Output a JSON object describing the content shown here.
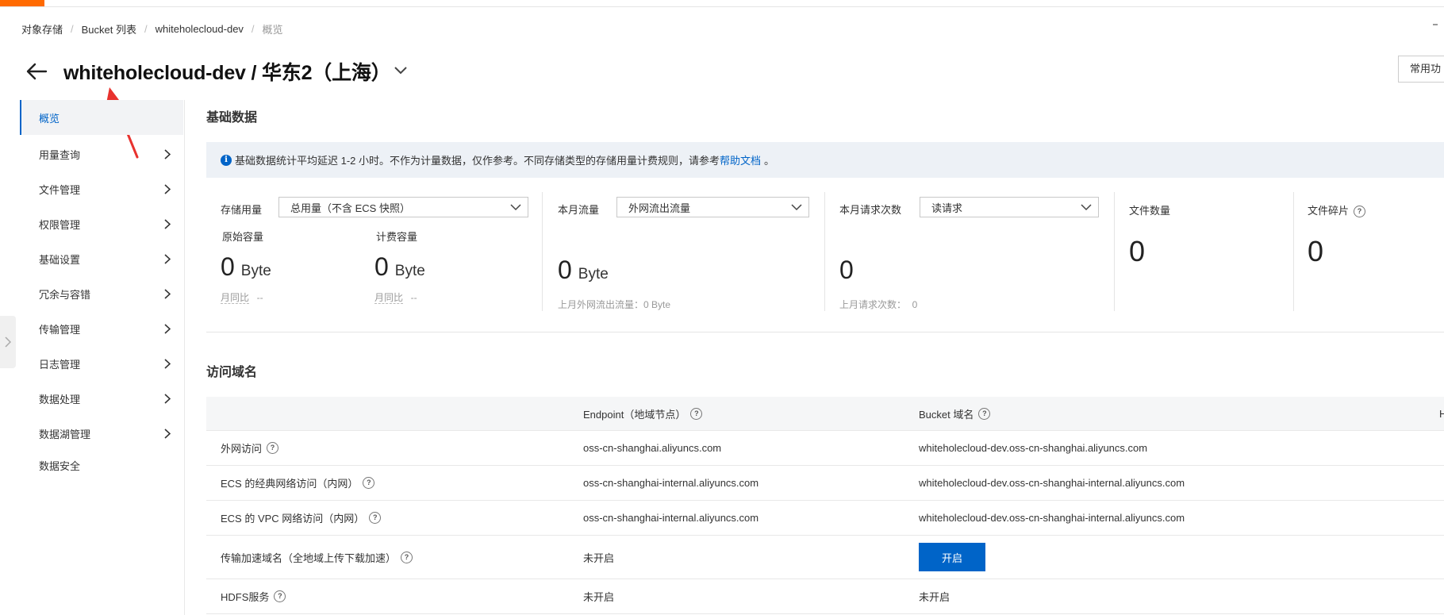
{
  "breadcrumb": [
    "对象存储",
    "Bucket 列表",
    "whiteholecloud-dev",
    "概览"
  ],
  "header": {
    "title": "whiteholecloud-dev / 华东2（上海）",
    "common_button": "常用功"
  },
  "sidebar": {
    "items": [
      {
        "label": "概览",
        "active": true,
        "expandable": false
      },
      {
        "label": "用量查询",
        "expandable": true
      },
      {
        "label": "文件管理",
        "expandable": true
      },
      {
        "label": "权限管理",
        "expandable": true
      },
      {
        "label": "基础设置",
        "expandable": true
      },
      {
        "label": "冗余与容错",
        "expandable": true
      },
      {
        "label": "传输管理",
        "expandable": true
      },
      {
        "label": "日志管理",
        "expandable": true
      },
      {
        "label": "数据处理",
        "expandable": true
      },
      {
        "label": "数据湖管理",
        "expandable": true
      },
      {
        "label": "数据安全",
        "expandable": false
      }
    ]
  },
  "basic": {
    "title": "基础数据",
    "notice_text": "基础数据统计平均延迟 1-2 小时。不作为计量数据，仅作参考。不同存储类型的存储用量计费规则，请参考",
    "notice_link": "帮助文档",
    "notice_end": "。",
    "storage": {
      "label": "存储用量",
      "select": "总用量（不含 ECS 快照）",
      "original_label": "原始容量",
      "original_value": "0",
      "original_unit": "Byte",
      "original_mom": "月同比",
      "original_mom_value": "--",
      "billing_label": "计费容量",
      "billing_value": "0",
      "billing_unit": "Byte",
      "billing_mom": "月同比",
      "billing_mom_value": "--"
    },
    "traffic": {
      "label": "本月流量",
      "select": "外网流出流量",
      "value": "0",
      "unit": "Byte",
      "last_month": "上月外网流出流量：0 Byte"
    },
    "requests": {
      "label": "本月请求次数",
      "select": "读请求",
      "value": "0",
      "last_month_label": "上月请求次数：",
      "last_month_value": "0"
    },
    "files": {
      "label": "文件数量",
      "value": "0"
    },
    "fragments": {
      "label": "文件碎片",
      "value": "0"
    }
  },
  "domains": {
    "title": "访问域名",
    "columns": [
      "Endpoint（地域节点）",
      "Bucket 域名",
      "H"
    ],
    "rows": [
      {
        "name": "外网访问",
        "endpoint": "oss-cn-shanghai.aliyuncs.com",
        "bucket": "whiteholecloud-dev.oss-cn-shanghai.aliyuncs.com"
      },
      {
        "name": "ECS 的经典网络访问（内网）",
        "endpoint": "oss-cn-shanghai-internal.aliyuncs.com",
        "bucket": "whiteholecloud-dev.oss-cn-shanghai-internal.aliyuncs.com"
      },
      {
        "name": "ECS 的 VPC 网络访问（内网）",
        "endpoint": "oss-cn-shanghai-internal.aliyuncs.com",
        "bucket": "whiteholecloud-dev.oss-cn-shanghai-internal.aliyuncs.com"
      },
      {
        "name": "传输加速域名（全地域上传下载加速）",
        "endpoint": "未开启",
        "bucket_button": "开启"
      },
      {
        "name": "HDFS服务",
        "endpoint": "未开启",
        "bucket": "未开启"
      }
    ]
  },
  "colors": {
    "accent": "#0064c8",
    "brand": "#ff6a00",
    "annotation": "#e8322e"
  }
}
